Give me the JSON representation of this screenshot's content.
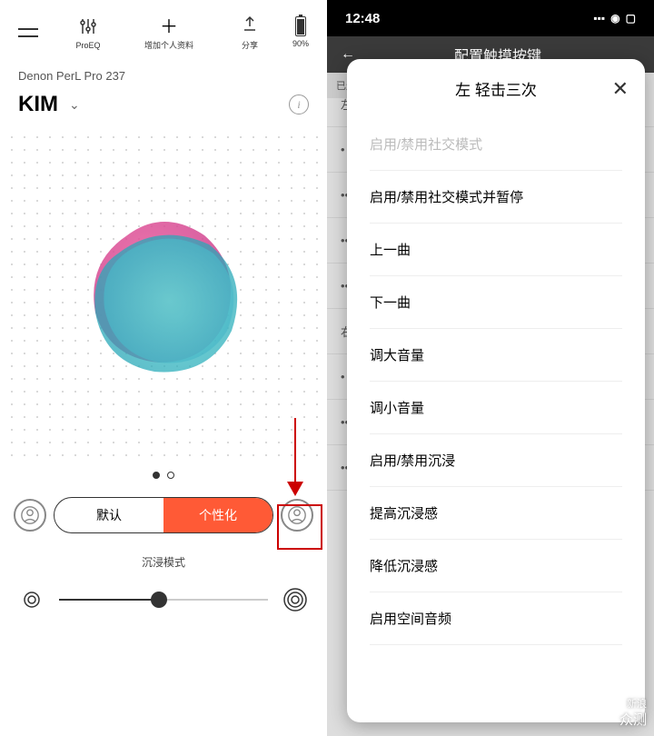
{
  "left": {
    "topbar": {
      "proeq": "ProEQ",
      "add_profile": "增加个人资料",
      "share": "分享",
      "battery": "90%"
    },
    "device": "Denon PerL Pro 237",
    "profile": "KIM",
    "segments": {
      "default": "默认",
      "personal": "个性化"
    },
    "immersion_label": "沉浸模式"
  },
  "right": {
    "time": "12:48",
    "back_title": "配置触摸按键",
    "connected": "已连",
    "left_key": "左键",
    "right_key": "右键",
    "modal_title": "左 轻击三次",
    "options": [
      {
        "label": "启用/禁用社交模式",
        "disabled": true
      },
      {
        "label": "启用/禁用社交模式并暂停",
        "disabled": false
      },
      {
        "label": "上一曲",
        "disabled": false
      },
      {
        "label": "下一曲",
        "disabled": false
      },
      {
        "label": "调大音量",
        "disabled": false
      },
      {
        "label": "调小音量",
        "disabled": false
      },
      {
        "label": "启用/禁用沉浸",
        "disabled": false
      },
      {
        "label": "提高沉浸感",
        "disabled": false
      },
      {
        "label": "降低沉浸感",
        "disabled": false
      },
      {
        "label": "启用空间音频",
        "disabled": false
      }
    ],
    "bg_dots": [
      "•",
      "••",
      "•••",
      "••••",
      "•",
      "••",
      "•••"
    ]
  },
  "watermark": {
    "l1": "新浪",
    "l2": "众测"
  }
}
